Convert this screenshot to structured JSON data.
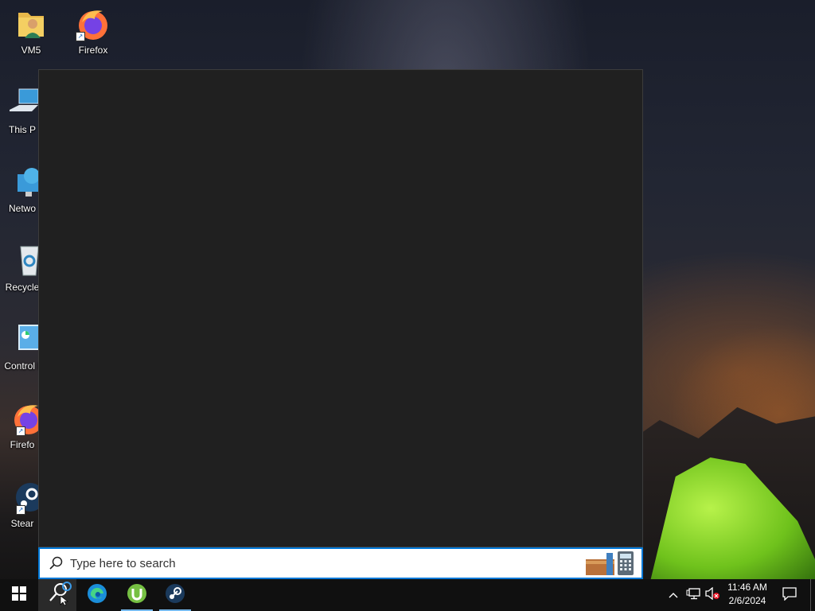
{
  "desktop": {
    "icons": [
      {
        "label": "VM5"
      },
      {
        "label": "Firefox"
      },
      {
        "label": "This P"
      },
      {
        "label": "Netwo"
      },
      {
        "label": "Recycle"
      },
      {
        "label": "Control I"
      },
      {
        "label": "Firefo"
      },
      {
        "label": "Stear"
      }
    ]
  },
  "search": {
    "placeholder": "Type here to search"
  },
  "taskbar": {
    "apps": [
      "start-icon",
      "search-icon",
      "edge-icon",
      "utorrent-icon",
      "steam-icon"
    ]
  },
  "clock": {
    "time": "11:46 AM",
    "date": "2/6/2024"
  },
  "colors": {
    "accent": "#0078d7",
    "panel": "#202020",
    "taskbar": "#101010"
  }
}
